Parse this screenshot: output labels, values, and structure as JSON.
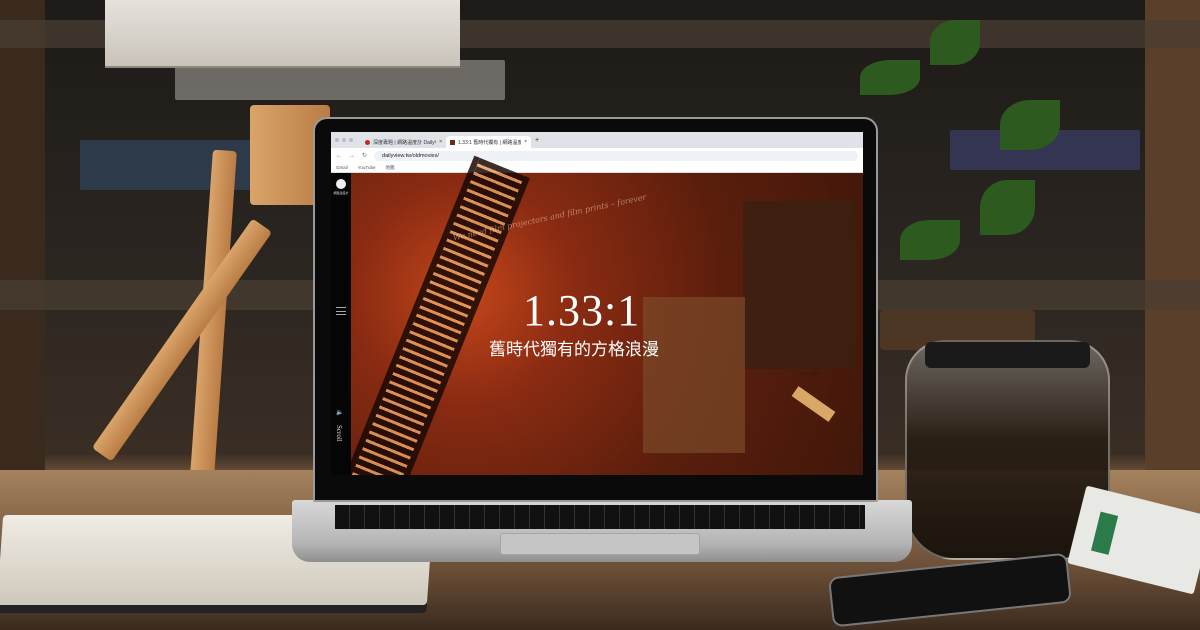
{
  "browser": {
    "tabs": [
      {
        "title": "深度專題 | 網路溫度計 DailyView"
      },
      {
        "title": "1.33:1 舊時代獨有 | 網路溫度計 D"
      }
    ],
    "new_tab": "+",
    "close": "×",
    "url": "dailyview.tw/oldmovies/",
    "bookmarks": [
      "Gmail",
      "YouTube",
      "地圖"
    ]
  },
  "site": {
    "logo_text": "網路溫度計",
    "script_line": "We need film projectors and film prints – forever",
    "headline": "1.33:1",
    "subtitle": "舊時代獨有的方格浪漫",
    "photo_caption": "the days",
    "scroll_label": "Scroll"
  }
}
